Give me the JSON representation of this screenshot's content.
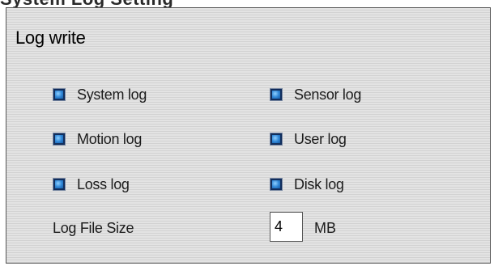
{
  "partial_heading": "System Log Setting",
  "section": {
    "title": "Log write"
  },
  "options": [
    {
      "label": "System log",
      "checked": true
    },
    {
      "label": "Sensor log",
      "checked": true
    },
    {
      "label": "Motion log",
      "checked": true
    },
    {
      "label": "User log",
      "checked": true
    },
    {
      "label": "Loss log",
      "checked": true
    },
    {
      "label": "Disk log",
      "checked": true
    }
  ],
  "log_file_size": {
    "label": "Log File Size",
    "value": "4",
    "unit": "MB"
  },
  "colors": {
    "checkbox_fill": "#2f86d6",
    "panel_bg": "#dcdcdc",
    "border": "#555555"
  }
}
